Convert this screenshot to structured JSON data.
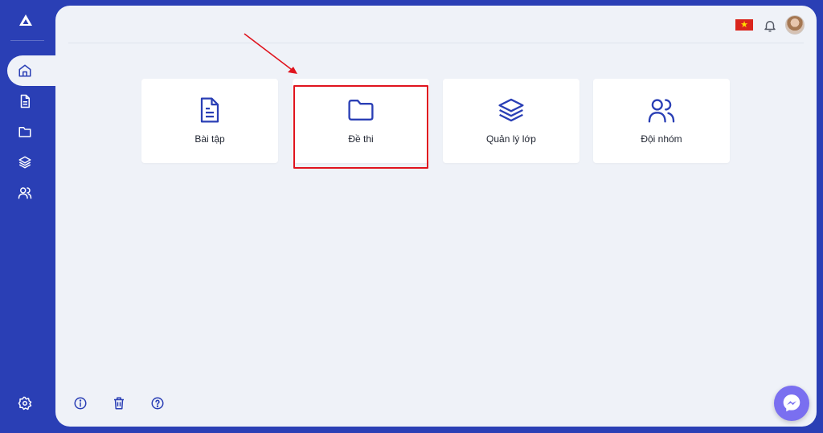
{
  "cards": [
    {
      "label": "Bài tập",
      "icon": "document-icon"
    },
    {
      "label": "Đề thi",
      "icon": "folder-icon"
    },
    {
      "label": "Quản lý lớp",
      "icon": "layers-icon"
    },
    {
      "label": "Đội nhóm",
      "icon": "users-icon"
    }
  ],
  "sidebar": {
    "items": [
      {
        "icon": "home-icon",
        "active": true
      },
      {
        "icon": "document-icon"
      },
      {
        "icon": "folder-icon"
      },
      {
        "icon": "layers-icon"
      },
      {
        "icon": "users-icon"
      }
    ],
    "settings_icon": "gear-icon"
  },
  "header": {
    "language_flag": "vietnam-flag-icon",
    "notifications_icon": "bell-icon",
    "avatar": "user-avatar"
  },
  "footer": {
    "icons": [
      "info-icon",
      "trash-icon",
      "help-icon"
    ]
  },
  "chat_widget": "messenger-icon",
  "colors": {
    "primary": "#2a3fb5",
    "background": "#eff2f8",
    "highlight": "#e0141e",
    "messenger": "#7a6ff0"
  }
}
